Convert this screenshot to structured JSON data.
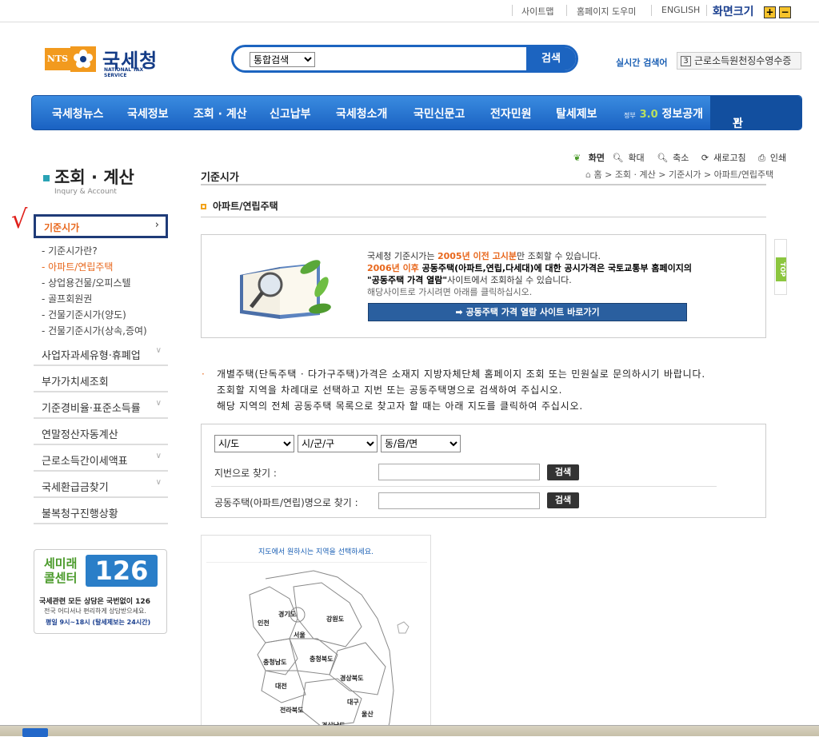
{
  "topbar": {
    "links": [
      "사이트맵",
      "홈페이지 도우미",
      "ENGLISH"
    ],
    "font_size_label": "화면크기",
    "zoom_in": "+",
    "zoom_out": "−"
  },
  "header": {
    "logo_badge": "NTS",
    "logo_name": "국세청",
    "logo_sub": "NATIONAL TAX SERVICE",
    "search_scope": "통합검색",
    "search_button": "검색",
    "realtime_label": "실시간 검색어",
    "realtime_rank": "3",
    "realtime_term": "근로소득원천징수영수증"
  },
  "nav": {
    "items": [
      "국세청뉴스",
      "국세정보",
      "조회 · 계산",
      "신고납부",
      "국세청소개",
      "국민신문고",
      "전자민원",
      "탈세제보"
    ],
    "open_prefix": "정부",
    "open_badge": "3.0",
    "open_label": "정보공개",
    "related": "관련사이트"
  },
  "sidebar": {
    "title": "조회 · 계산",
    "subtitle": "Inqury & Account",
    "active": "기준시가",
    "sub_items": [
      {
        "label": "- 기준시가란?",
        "on": false
      },
      {
        "label": "- 아파트/연립주택",
        "on": true
      },
      {
        "label": "- 상업용건물/오피스텔",
        "on": false
      },
      {
        "label": "- 골프회원권",
        "on": false
      },
      {
        "label": "- 건물기준시가(양도)",
        "on": false
      },
      {
        "label": "- 건물기준시가(상속,증여)",
        "on": false
      }
    ],
    "menus": [
      "사업자과세유형·휴폐업",
      "부가가치세조회",
      "기준경비율·표준소득률",
      "연말정산자동계산",
      "근로소득간이세액표",
      "국세환급금찾기",
      "불복청구진행상황"
    ],
    "callcenter": {
      "text1": "세미래",
      "text2": "콜센터",
      "number": "126",
      "line1": "국세관련 모든 상담은 국번없이 126",
      "line2": "전국 어디서나 편리하게 상담받으세요.",
      "line3": "평일 9시~18시 (탈세제보는 24시간)"
    }
  },
  "content": {
    "tools": [
      "화면",
      "확대",
      "축소",
      "새로고침",
      "인쇄"
    ],
    "page_title": "기준시가",
    "breadcrumb": "홈 > 조회 · 계산 > 기준시가 > 아파트/연립주택",
    "subtitle": "아파트/연립주택",
    "info": {
      "l1a": "국세청 기준시가는 ",
      "l1b": "2005년 이전 고시분",
      "l1c": "만 조회할 수 있습니다.",
      "l2a": "2006년 이후 ",
      "l2b": "공동주택(아파트,연립,다세대)에 대한 공시가격은 국토교통부 홈페이지의",
      "l3a": "\"공동주택 가격 열람\"",
      "l3b": "사이트에서 조회하실 수 있습니다.",
      "l4": "해당사이트로 가시려면 아래를 클릭하십시오.",
      "link": "➡ 공동주택 가격 열람 사이트 바로가기"
    },
    "top_button": "TOP",
    "notice": [
      "개별주택(단독주택 · 다가구주택)가격은 소재지 지방자체단체 홈페이지 조회 또는 민원실로 문의하시기 바랍니다.",
      "조회할 지역을 차례대로 선택하고 지번 또는 공동주택명으로 검색하여 주십시오.",
      "해당 지역의 전체 공동주택 목록으로 찾고자 할 때는 아래 지도를 클릭하여 주십시오."
    ],
    "selects": [
      "시/도",
      "시/군/구",
      "동/읍/면"
    ],
    "search_jibun_label": "지번으로 찾기 :",
    "search_name_label": "공동주택(아파트/연립)명으로 찾기 :",
    "search_button": "검색",
    "map": {
      "title": "지도에서 원하시는 지역을 선택하세요.",
      "regions": [
        "경기도",
        "강원도",
        "인천",
        "서울",
        "충청남도",
        "충청북도",
        "대전",
        "경상북도",
        "전라북도",
        "대구",
        "울산",
        "경상남도"
      ]
    }
  }
}
